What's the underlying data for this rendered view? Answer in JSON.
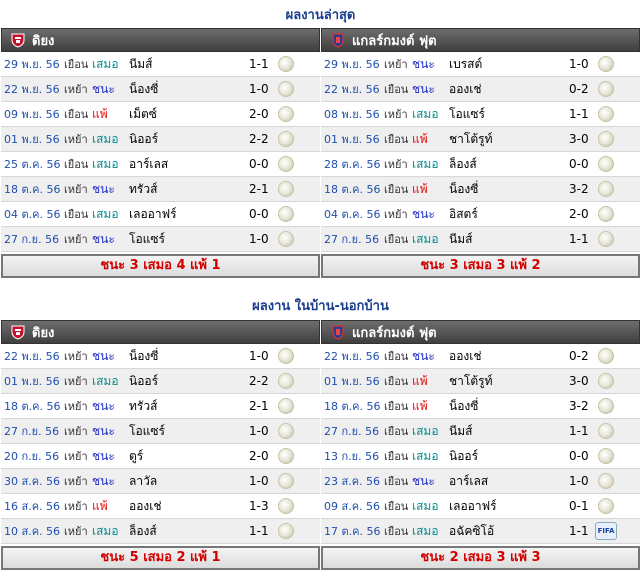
{
  "sections": [
    {
      "title": "ผลงานล่าสุด",
      "left": {
        "team": "ดิยง",
        "rows": [
          {
            "date": "29 พ.ย. 56",
            "ha": "เยือน",
            "result": "เสมอ",
            "rtype": "draw",
            "opp": "นีมส์",
            "score": "1-1"
          },
          {
            "date": "22 พ.ย. 56",
            "ha": "เหย้า",
            "result": "ชนะ",
            "rtype": "win",
            "opp": "น็องซี่",
            "score": "1-0"
          },
          {
            "date": "09 พ.ย. 56",
            "ha": "เยือน",
            "result": "แพ้",
            "rtype": "loss",
            "opp": "เม็ตซ์",
            "score": "2-0"
          },
          {
            "date": "01 พ.ย. 56",
            "ha": "เหย้า",
            "result": "เสมอ",
            "rtype": "draw",
            "opp": "นิออร์",
            "score": "2-2"
          },
          {
            "date": "25 ต.ค. 56",
            "ha": "เยือน",
            "result": "เสมอ",
            "rtype": "draw",
            "opp": "อาร์เลส",
            "score": "0-0"
          },
          {
            "date": "18 ต.ค. 56",
            "ha": "เหย้า",
            "result": "ชนะ",
            "rtype": "win",
            "opp": "ทรัวส์",
            "score": "2-1"
          },
          {
            "date": "04 ต.ค. 56",
            "ha": "เยือน",
            "result": "เสมอ",
            "rtype": "draw",
            "opp": "เลออาฟร์",
            "score": "0-0"
          },
          {
            "date": "27 ก.ย. 56",
            "ha": "เหย้า",
            "result": "ชนะ",
            "rtype": "win",
            "opp": "โอแซร์",
            "score": "1-0"
          }
        ],
        "summary": "ชนะ 3 เสมอ 4 แพ้ 1"
      },
      "right": {
        "team": "แกลร์กมงต์ ฟุต",
        "rows": [
          {
            "date": "29 พ.ย. 56",
            "ha": "เหย้า",
            "result": "ชนะ",
            "rtype": "win",
            "opp": "เบรสต์",
            "score": "1-0"
          },
          {
            "date": "22 พ.ย. 56",
            "ha": "เยือน",
            "result": "ชนะ",
            "rtype": "win",
            "opp": "อองเช่",
            "score": "0-2"
          },
          {
            "date": "08 พ.ย. 56",
            "ha": "เหย้า",
            "result": "เสมอ",
            "rtype": "draw",
            "opp": "โอแซร์",
            "score": "1-1"
          },
          {
            "date": "01 พ.ย. 56",
            "ha": "เยือน",
            "result": "แพ้",
            "rtype": "loss",
            "opp": "ชาโต้รูท์",
            "score": "3-0"
          },
          {
            "date": "28 ต.ค. 56",
            "ha": "เหย้า",
            "result": "เสมอ",
            "rtype": "draw",
            "opp": "ล็องส์",
            "score": "0-0"
          },
          {
            "date": "18 ต.ค. 56",
            "ha": "เยือน",
            "result": "แพ้",
            "rtype": "loss",
            "opp": "น็องซี่",
            "score": "3-2"
          },
          {
            "date": "04 ต.ค. 56",
            "ha": "เหย้า",
            "result": "ชนะ",
            "rtype": "win",
            "opp": "อิสตร์",
            "score": "2-0"
          },
          {
            "date": "27 ก.ย. 56",
            "ha": "เยือน",
            "result": "เสมอ",
            "rtype": "draw",
            "opp": "นีมส์",
            "score": "1-1"
          }
        ],
        "summary": "ชนะ 3 เสมอ 3 แพ้ 2"
      }
    },
    {
      "title": "ผลงาน ในบ้าน-นอกบ้าน",
      "left": {
        "team": "ดิยง",
        "rows": [
          {
            "date": "22 พ.ย. 56",
            "ha": "เหย้า",
            "result": "ชนะ",
            "rtype": "win",
            "opp": "น็องซี่",
            "score": "1-0"
          },
          {
            "date": "01 พ.ย. 56",
            "ha": "เหย้า",
            "result": "เสมอ",
            "rtype": "draw",
            "opp": "นิออร์",
            "score": "2-2"
          },
          {
            "date": "18 ต.ค. 56",
            "ha": "เหย้า",
            "result": "ชนะ",
            "rtype": "win",
            "opp": "ทรัวส์",
            "score": "2-1"
          },
          {
            "date": "27 ก.ย. 56",
            "ha": "เหย้า",
            "result": "ชนะ",
            "rtype": "win",
            "opp": "โอแซร์",
            "score": "1-0"
          },
          {
            "date": "20 ก.ย. 56",
            "ha": "เหย้า",
            "result": "ชนะ",
            "rtype": "win",
            "opp": "ตูร์",
            "score": "2-0"
          },
          {
            "date": "30 ส.ค. 56",
            "ha": "เหย้า",
            "result": "ชนะ",
            "rtype": "win",
            "opp": "ลาวัล",
            "score": "1-0"
          },
          {
            "date": "16 ส.ค. 56",
            "ha": "เหย้า",
            "result": "แพ้",
            "rtype": "loss",
            "opp": "อองเช่",
            "score": "1-3"
          },
          {
            "date": "10 ส.ค. 56",
            "ha": "เหย้า",
            "result": "เสมอ",
            "rtype": "draw",
            "opp": "ล็องส์",
            "score": "1-1"
          }
        ],
        "summary": "ชนะ 5 เสมอ 2 แพ้ 1"
      },
      "right": {
        "team": "แกลร์กมงต์ ฟุต",
        "rows": [
          {
            "date": "22 พ.ย. 56",
            "ha": "เยือน",
            "result": "ชนะ",
            "rtype": "win",
            "opp": "อองเช่",
            "score": "0-2"
          },
          {
            "date": "01 พ.ย. 56",
            "ha": "เยือน",
            "result": "แพ้",
            "rtype": "loss",
            "opp": "ชาโต้รูท์",
            "score": "3-0"
          },
          {
            "date": "18 ต.ค. 56",
            "ha": "เยือน",
            "result": "แพ้",
            "rtype": "loss",
            "opp": "น็องซี่",
            "score": "3-2"
          },
          {
            "date": "27 ก.ย. 56",
            "ha": "เยือน",
            "result": "เสมอ",
            "rtype": "draw",
            "opp": "นีมส์",
            "score": "1-1"
          },
          {
            "date": "13 ก.ย. 56",
            "ha": "เยือน",
            "result": "เสมอ",
            "rtype": "draw",
            "opp": "นิออร์",
            "score": "0-0"
          },
          {
            "date": "23 ส.ค. 56",
            "ha": "เยือน",
            "result": "ชนะ",
            "rtype": "win",
            "opp": "อาร์เลส",
            "score": "1-0"
          },
          {
            "date": "09 ส.ค. 56",
            "ha": "เยือน",
            "result": "เสมอ",
            "rtype": "draw",
            "opp": "เลออาฟร์",
            "score": "0-1"
          },
          {
            "date": "17 ต.ค. 56",
            "ha": "เยือน",
            "result": "เสมอ",
            "rtype": "draw",
            "opp": "อฉัคซิโอ้",
            "score": "1-1",
            "icon": "fifa",
            "icon_text": "FIFA"
          }
        ],
        "summary": "ชนะ 2 เสมอ 3 แพ้ 3"
      }
    }
  ],
  "colors": {
    "win": "#1f2fc8",
    "draw": "#0a8a8a",
    "loss": "#e01010",
    "summary": "#d40000",
    "title": "#1a3f8c"
  },
  "icons": {
    "left_crest": "dijon-crest-icon",
    "right_crest": "clermont-crest-icon",
    "league": "league-ball-icon"
  }
}
